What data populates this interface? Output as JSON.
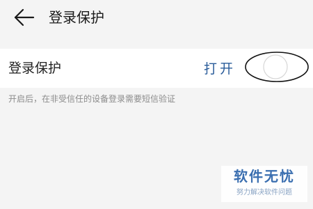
{
  "header": {
    "title": "登录保护",
    "back_icon": "back-arrow-icon"
  },
  "setting": {
    "label": "登录保护",
    "annotation": "打开",
    "toggle_state": "off"
  },
  "hint": "开启后，在非受信任的设备登录需要短信验证",
  "watermark": {
    "title": "软件无忧",
    "subtitle": "努力解决软件问题"
  }
}
